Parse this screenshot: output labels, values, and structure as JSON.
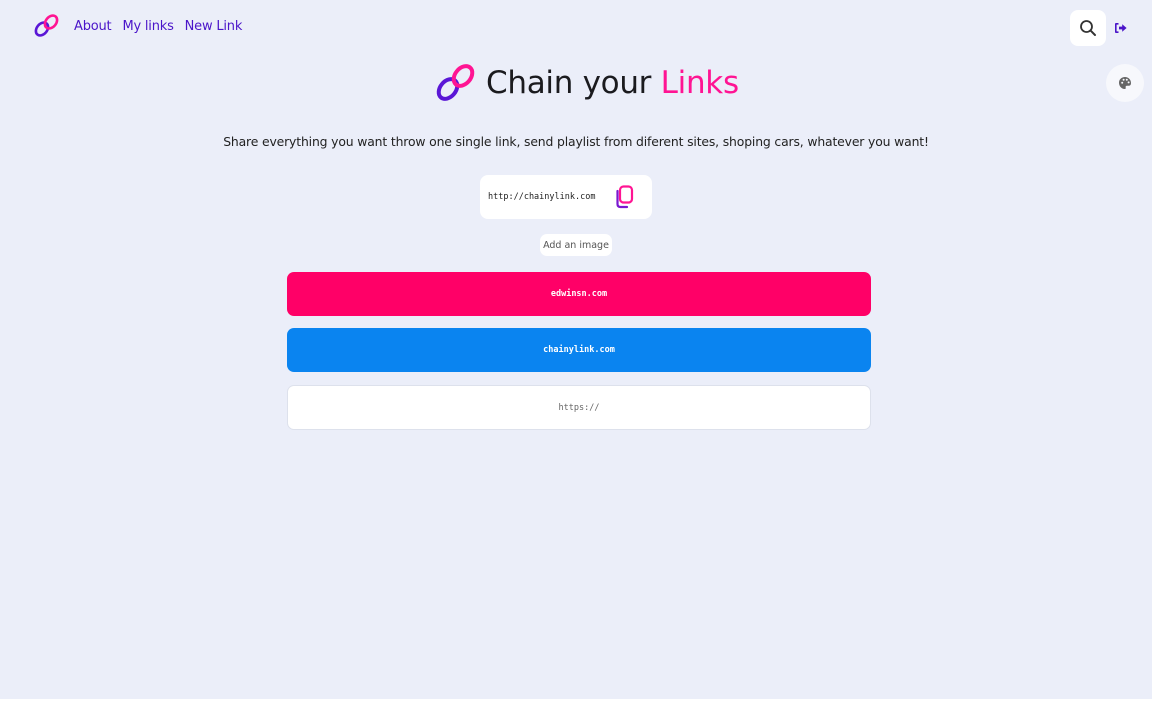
{
  "nav": {
    "links": [
      "About",
      "My links",
      "New Link"
    ]
  },
  "hero": {
    "title_main": "Chain your",
    "title_accent": "Links"
  },
  "tagline": "Share everything you want throw one single link, send playlist from diferent sites, shoping cars, whatever you want!",
  "share": {
    "url": "http://chainylink.com",
    "add_image_label": "Add an image"
  },
  "links": [
    {
      "label": "edwinsn.com",
      "color": "#ff0067"
    },
    {
      "label": "chainylink.com",
      "color": "#0a84f0"
    }
  ],
  "new_link": {
    "placeholder": "https://"
  },
  "icons": {
    "logo": "chain-link-icon",
    "search": "search-icon",
    "logout": "logout-icon",
    "theme": "palette-icon",
    "copy": "copy-icon"
  },
  "colors": {
    "brand_purple": "#4a14c9",
    "brand_pink": "#ff1493",
    "background": "#ebeef9"
  }
}
